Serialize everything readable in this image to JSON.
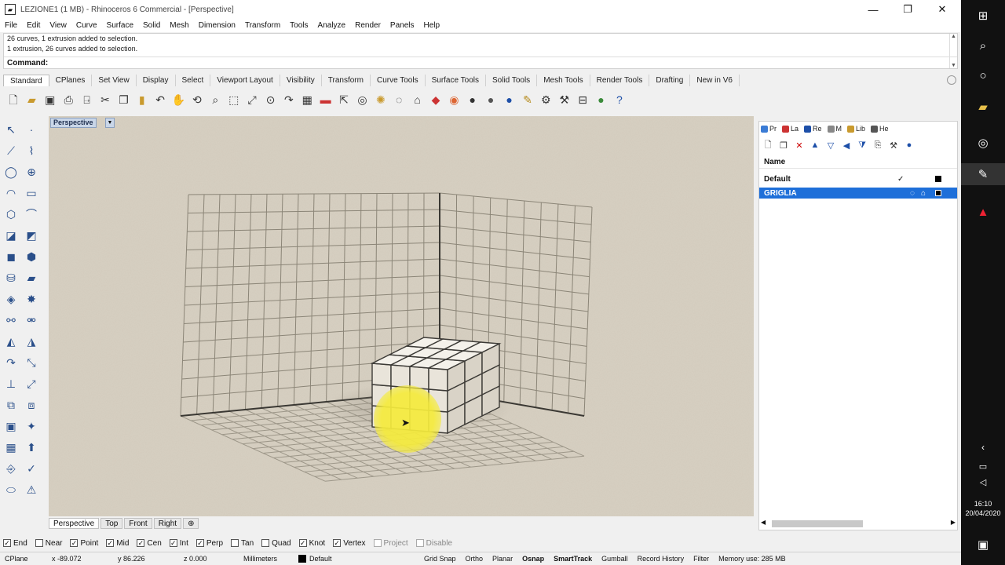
{
  "window": {
    "title": "LEZIONE1 (1 MB) - Rhinoceros 6 Commercial - [Perspective]",
    "app_icon": "rhino-icon",
    "controls": [
      "—",
      "❐",
      "✕"
    ]
  },
  "menu": [
    "File",
    "Edit",
    "View",
    "Curve",
    "Surface",
    "Solid",
    "Mesh",
    "Dimension",
    "Transform",
    "Tools",
    "Analyze",
    "Render",
    "Panels",
    "Help"
  ],
  "command": {
    "history": [
      "26 curves, 1 extrusion added to selection.",
      "1 extrusion, 26 curves added to selection."
    ],
    "prompt": "Command:",
    "value": ""
  },
  "toolbar_tabs": [
    "Standard",
    "CPlanes",
    "Set View",
    "Display",
    "Select",
    "Viewport Layout",
    "Visibility",
    "Transform",
    "Curve Tools",
    "Surface Tools",
    "Solid Tools",
    "Mesh Tools",
    "Render Tools",
    "Drafting",
    "New in V6"
  ],
  "active_toolbar_tab": "Standard",
  "toolbar_icons": [
    "new-file-icon",
    "open-icon",
    "save-icon",
    "print-icon",
    "import-icon",
    "cut-icon",
    "copy-icon",
    "paste-icon",
    "undo-icon",
    "pan-hand-icon",
    "rotate-view-icon",
    "zoom-icon",
    "zoom-window-icon",
    "zoom-extents-icon",
    "zoom-selected-icon",
    "redo-view-icon",
    "grid-icon",
    "move-icon",
    "select-icon",
    "object-snap-icon",
    "visibility-icon",
    "lightbulb-icon",
    "lock-icon",
    "properties-icon",
    "color-wheel-icon",
    "shade-icon",
    "rendered-sphere-icon",
    "render-icon",
    "materials-icon",
    "options-icon",
    "tools-icon",
    "layout-icon",
    "rhino-globe-icon",
    "help-icon"
  ],
  "viewport": {
    "label": "Perspective",
    "tabs": [
      "Perspective",
      "Top",
      "Front",
      "Right"
    ],
    "active_tab": "Perspective"
  },
  "panel": {
    "tabs": [
      "Pr",
      "La",
      "Re",
      "M",
      "Lib",
      "He"
    ],
    "column_header": "Name",
    "layers": [
      {
        "name": "Default",
        "current": "✓",
        "color": "#000000",
        "selected": false
      },
      {
        "name": "GRIGLIA",
        "current": "",
        "color": "#000000",
        "selected": true
      }
    ]
  },
  "osnap": [
    {
      "label": "End",
      "checked": true
    },
    {
      "label": "Near",
      "checked": false
    },
    {
      "label": "Point",
      "checked": true
    },
    {
      "label": "Mid",
      "checked": true
    },
    {
      "label": "Cen",
      "checked": true
    },
    {
      "label": "Int",
      "checked": true
    },
    {
      "label": "Perp",
      "checked": true
    },
    {
      "label": "Tan",
      "checked": false
    },
    {
      "label": "Quad",
      "checked": false
    },
    {
      "label": "Knot",
      "checked": true
    },
    {
      "label": "Vertex",
      "checked": true
    },
    {
      "label": "Project",
      "checked": false
    },
    {
      "label": "Disable",
      "checked": false
    }
  ],
  "status": {
    "cplane": "CPlane",
    "x": "x -89.072",
    "y": "y 86.226",
    "z": "z 0.000",
    "units": "Millimeters",
    "layer": "Default",
    "toggles": [
      "Grid Snap",
      "Ortho",
      "Planar",
      "Osnap",
      "SmartTrack",
      "Gumball",
      "Record History",
      "Filter"
    ],
    "memory": "Memory use: 285 MB"
  },
  "taskbar": {
    "icons": [
      "windows-icon",
      "search-icon",
      "cortana-icon",
      "file-explorer-icon",
      "chrome-icon",
      "rhino-app-icon",
      "acrobat-icon"
    ],
    "tray": [
      "chevron-up-icon",
      "network-icon",
      "volume-icon"
    ],
    "time": "16:10",
    "date": "20/04/2020",
    "notification": "notification-icon"
  }
}
